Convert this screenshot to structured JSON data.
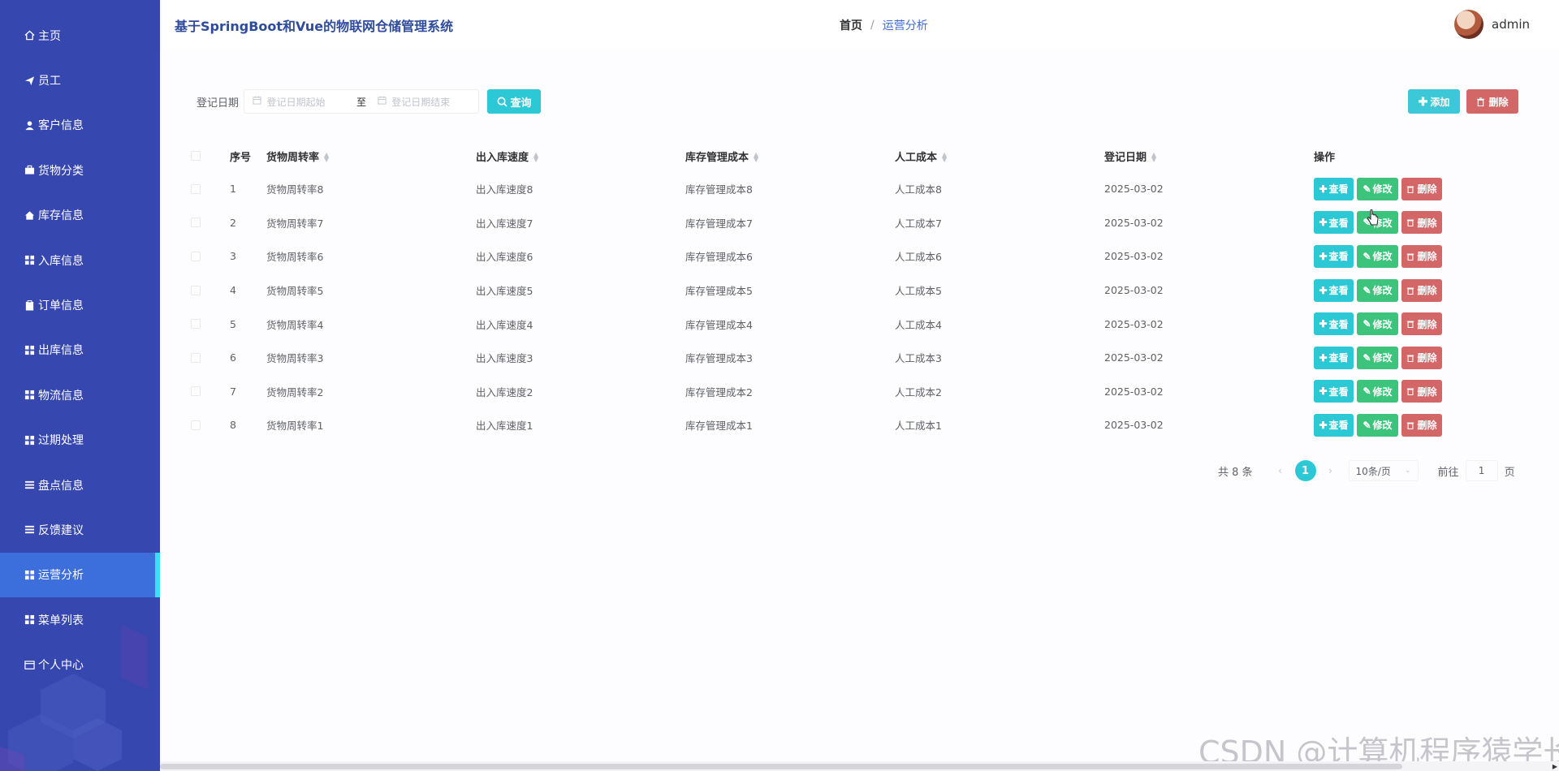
{
  "sidebar": {
    "items": [
      {
        "label": "主页",
        "icon": "home-icon"
      },
      {
        "label": "员工",
        "icon": "send-icon"
      },
      {
        "label": "客户信息",
        "icon": "user-icon"
      },
      {
        "label": "货物分类",
        "icon": "briefcase-icon"
      },
      {
        "label": "库存信息",
        "icon": "house-icon"
      },
      {
        "label": "入库信息",
        "icon": "grid-icon"
      },
      {
        "label": "订单信息",
        "icon": "clipboard-icon"
      },
      {
        "label": "出库信息",
        "icon": "grid-icon"
      },
      {
        "label": "物流信息",
        "icon": "grid-icon"
      },
      {
        "label": "过期处理",
        "icon": "grid-icon"
      },
      {
        "label": "盘点信息",
        "icon": "list-icon"
      },
      {
        "label": "反馈建议",
        "icon": "list-icon"
      },
      {
        "label": "运营分析",
        "icon": "grid-icon",
        "active": true
      },
      {
        "label": "菜单列表",
        "icon": "grid-icon"
      },
      {
        "label": "个人中心",
        "icon": "card-icon"
      }
    ],
    "bg_color": "#3747b0",
    "active_color": "#3d6fdc"
  },
  "header": {
    "title": "基于SpringBoot和Vue的物联网仓储管理系统",
    "breadcrumb_home": "首页",
    "breadcrumb_sep": "/",
    "breadcrumb_current": "运营分析",
    "username": "admin"
  },
  "search": {
    "label": "登记日期",
    "start_placeholder": "登记日期起始",
    "range_separator": "至",
    "end_placeholder": "登记日期结束",
    "search_button": "查询",
    "add_button": "添加",
    "delete_button": "删除"
  },
  "table": {
    "headers": {
      "index": "序号",
      "col_a": "货物周转率",
      "col_b": "出入库速度",
      "col_c": "库存管理成本",
      "col_d": "人工成本",
      "col_e": "登记日期",
      "op": "操作"
    },
    "rows": [
      {
        "index": "1",
        "a": "货物周转率8",
        "b": "出入库速度8",
        "c": "库存管理成本8",
        "d": "人工成本8",
        "e": "2025-03-02"
      },
      {
        "index": "2",
        "a": "货物周转率7",
        "b": "出入库速度7",
        "c": "库存管理成本7",
        "d": "人工成本7",
        "e": "2025-03-02"
      },
      {
        "index": "3",
        "a": "货物周转率6",
        "b": "出入库速度6",
        "c": "库存管理成本6",
        "d": "人工成本6",
        "e": "2025-03-02"
      },
      {
        "index": "4",
        "a": "货物周转率5",
        "b": "出入库速度5",
        "c": "库存管理成本5",
        "d": "人工成本5",
        "e": "2025-03-02"
      },
      {
        "index": "5",
        "a": "货物周转率4",
        "b": "出入库速度4",
        "c": "库存管理成本4",
        "d": "人工成本4",
        "e": "2025-03-02"
      },
      {
        "index": "6",
        "a": "货物周转率3",
        "b": "出入库速度3",
        "c": "库存管理成本3",
        "d": "人工成本3",
        "e": "2025-03-02"
      },
      {
        "index": "7",
        "a": "货物周转率2",
        "b": "出入库速度2",
        "c": "库存管理成本2",
        "d": "人工成本2",
        "e": "2025-03-02"
      },
      {
        "index": "8",
        "a": "货物周转率1",
        "b": "出入库速度1",
        "c": "库存管理成本1",
        "d": "人工成本1",
        "e": "2025-03-02"
      }
    ],
    "row_actions": {
      "view": "查看",
      "edit": "修改",
      "delete": "删除"
    }
  },
  "pagination": {
    "total": "共 8 条",
    "current_page": "1",
    "page_size": "10条/页",
    "goto_prefix": "前往",
    "goto_value": "1",
    "goto_suffix": "页"
  },
  "watermark": "CSDN @计算机程序猿学长",
  "colors": {
    "accent": "#2cc8d6",
    "edit": "#3cc47c",
    "danger": "#d36666"
  }
}
